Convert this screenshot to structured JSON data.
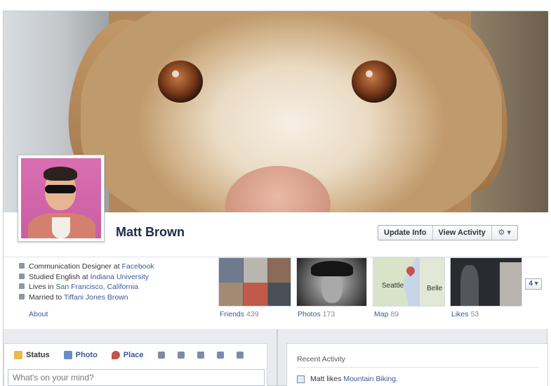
{
  "profile": {
    "name": "Matt Brown",
    "actions": {
      "update_info": "Update Info",
      "view_activity": "View Activity",
      "settings": "⚙ ▾"
    }
  },
  "info": {
    "work": {
      "prefix": "Communication Designer at",
      "link": "Facebook"
    },
    "study": {
      "prefix": "Studied English at",
      "link": "Indiana University"
    },
    "lives": {
      "prefix": "Lives in",
      "link": "San Francisco, California"
    },
    "married": {
      "prefix": "Married to",
      "link": "Tiffani Jones Brown"
    },
    "about_label": "About"
  },
  "tiles": {
    "friends": {
      "label": "Friends",
      "count": "439"
    },
    "photos": {
      "label": "Photos",
      "count": "173"
    },
    "map": {
      "label": "Map",
      "count": "89",
      "city1": "Seattle",
      "city2": "Belle"
    },
    "likes": {
      "label": "Likes",
      "count": "53"
    },
    "more": "4 ▾"
  },
  "composer": {
    "tabs": {
      "status": "Status",
      "photo": "Photo",
      "place": "Place"
    },
    "placeholder": "What's on your mind?"
  },
  "recent_activity": {
    "title": "Recent Activity",
    "item": {
      "text": "Matt likes",
      "link": "Mountain Biking."
    }
  },
  "colors": {
    "link": "#3b5998",
    "background": "#e9ebee"
  }
}
